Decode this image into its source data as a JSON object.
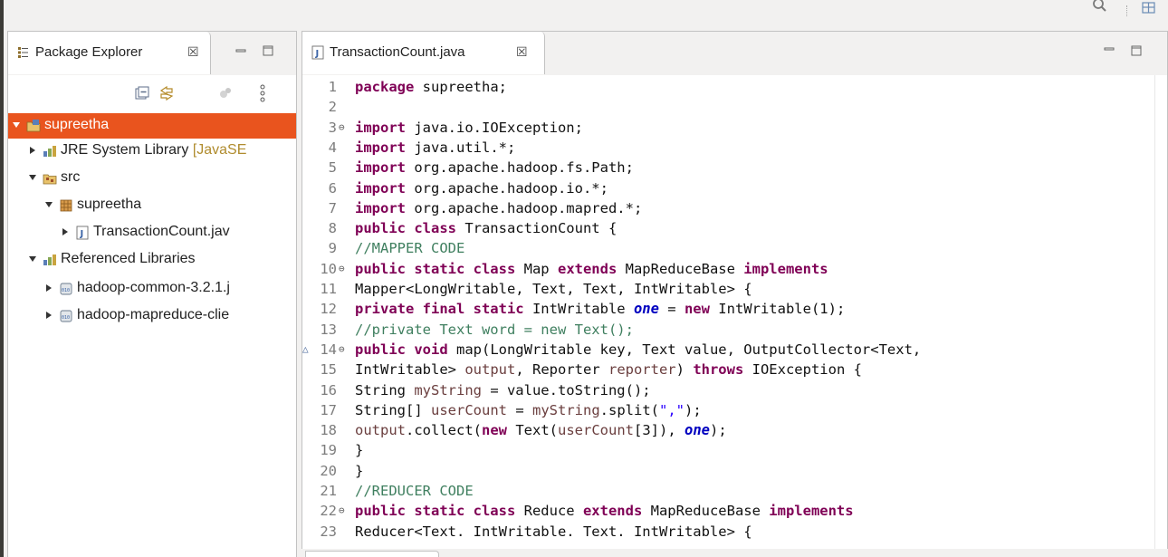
{
  "package_explorer": {
    "tab_label": "Package Explorer",
    "close_glyph": "☒",
    "tree": [
      {
        "label": "supreetha",
        "suffix": "",
        "icon": "project-icon",
        "expanded": true,
        "depth": 0,
        "selected": true
      },
      {
        "label": "JRE System Library ",
        "suffix": "[JavaSE",
        "icon": "library-icon",
        "expanded": false,
        "depth": 1,
        "selected": false
      },
      {
        "label": "src",
        "suffix": "",
        "icon": "source-folder-icon",
        "expanded": true,
        "depth": 1,
        "selected": false
      },
      {
        "label": "supreetha",
        "suffix": "",
        "icon": "package-icon",
        "expanded": true,
        "depth": 2,
        "selected": false
      },
      {
        "label": "TransactionCount.jav",
        "suffix": "",
        "icon": "java-file-icon",
        "expanded": false,
        "depth": 3,
        "selected": false
      },
      {
        "label": "Referenced Libraries",
        "suffix": "",
        "icon": "library-icon",
        "expanded": true,
        "depth": 1,
        "selected": false
      },
      {
        "label": "hadoop-common-3.2.1.j",
        "suffix": "",
        "icon": "jar-icon",
        "expanded": false,
        "depth": 2,
        "selected": false
      },
      {
        "label": "hadoop-mapreduce-clie",
        "suffix": "",
        "icon": "jar-icon",
        "expanded": false,
        "depth": 2,
        "selected": false
      }
    ]
  },
  "editor": {
    "tab_label": "TransactionCount.java",
    "close_glyph": "☒",
    "lines": [
      {
        "n": "1",
        "fold": "",
        "override": "",
        "tokens": [
          [
            "kw",
            "package"
          ],
          [
            "pl",
            " supreetha;"
          ]
        ]
      },
      {
        "n": "2",
        "fold": "",
        "override": "",
        "tokens": []
      },
      {
        "n": "3",
        "fold": "⊖",
        "override": "",
        "tokens": [
          [
            "kw",
            "import"
          ],
          [
            "pl",
            " java.io.IOException;"
          ]
        ]
      },
      {
        "n": "4",
        "fold": "",
        "override": "",
        "tokens": [
          [
            "kw",
            "import"
          ],
          [
            "pl",
            " java.util.*;"
          ]
        ]
      },
      {
        "n": "5",
        "fold": "",
        "override": "",
        "tokens": [
          [
            "kw",
            "import"
          ],
          [
            "pl",
            " org.apache.hadoop.fs.Path;"
          ]
        ]
      },
      {
        "n": "6",
        "fold": "",
        "override": "",
        "tokens": [
          [
            "kw",
            "import"
          ],
          [
            "pl",
            " org.apache.hadoop.io.*;"
          ]
        ]
      },
      {
        "n": "7",
        "fold": "",
        "override": "",
        "tokens": [
          [
            "kw",
            "import"
          ],
          [
            "pl",
            " org.apache.hadoop.mapred.*;"
          ]
        ]
      },
      {
        "n": "8",
        "fold": "",
        "override": "",
        "tokens": [
          [
            "kw",
            "public class"
          ],
          [
            "pl",
            " TransactionCount {"
          ]
        ]
      },
      {
        "n": "9",
        "fold": "",
        "override": "",
        "tokens": [
          [
            "cm",
            "//MAPPER CODE"
          ]
        ]
      },
      {
        "n": "10",
        "fold": "⊖",
        "override": "",
        "tokens": [
          [
            "kw",
            "public static class"
          ],
          [
            "pl",
            " Map "
          ],
          [
            "kw",
            "extends"
          ],
          [
            "pl",
            " MapReduceBase "
          ],
          [
            "kw",
            "implements"
          ]
        ]
      },
      {
        "n": "11",
        "fold": "",
        "override": "",
        "tokens": [
          [
            "pl",
            "Mapper<LongWritable, Text, Text, IntWritable> {"
          ]
        ]
      },
      {
        "n": "12",
        "fold": "",
        "override": "",
        "tokens": [
          [
            "kw",
            "private final static"
          ],
          [
            "pl",
            " IntWritable "
          ],
          [
            "fld",
            "one"
          ],
          [
            "pl",
            " = "
          ],
          [
            "kw",
            "new"
          ],
          [
            "pl",
            " IntWritable(1);"
          ]
        ]
      },
      {
        "n": "13",
        "fold": "",
        "override": "",
        "tokens": [
          [
            "cm",
            "//private Text word = new Text();"
          ]
        ]
      },
      {
        "n": "14",
        "fold": "⊖",
        "override": "△",
        "tokens": [
          [
            "kw",
            "public void"
          ],
          [
            "pl",
            " map(LongWritable key, Text value, OutputCollector<Text,"
          ]
        ]
      },
      {
        "n": "15",
        "fold": "",
        "override": "",
        "tokens": [
          [
            "pl",
            "IntWritable> "
          ],
          [
            "var",
            "output"
          ],
          [
            "pl",
            ", Reporter "
          ],
          [
            "var",
            "reporter"
          ],
          [
            "pl",
            ") "
          ],
          [
            "kw",
            "throws"
          ],
          [
            "pl",
            " IOException {"
          ]
        ]
      },
      {
        "n": "16",
        "fold": "",
        "override": "",
        "tokens": [
          [
            "pl",
            "String "
          ],
          [
            "var",
            "myString"
          ],
          [
            "pl",
            " = value.toString();"
          ]
        ]
      },
      {
        "n": "17",
        "fold": "",
        "override": "",
        "tokens": [
          [
            "pl",
            "String[] "
          ],
          [
            "var",
            "userCount"
          ],
          [
            "pl",
            " = "
          ],
          [
            "var",
            "myString"
          ],
          [
            "pl",
            ".split("
          ],
          [
            "str",
            "\",\""
          ],
          [
            "pl",
            ");"
          ]
        ]
      },
      {
        "n": "18",
        "fold": "",
        "override": "",
        "tokens": [
          [
            "var",
            "output"
          ],
          [
            "pl",
            ".collect("
          ],
          [
            "kw",
            "new"
          ],
          [
            "pl",
            " Text("
          ],
          [
            "var",
            "userCount"
          ],
          [
            "pl",
            "[3]), "
          ],
          [
            "fld",
            "one"
          ],
          [
            "pl",
            ");"
          ]
        ]
      },
      {
        "n": "19",
        "fold": "",
        "override": "",
        "tokens": [
          [
            "pl",
            "}"
          ]
        ]
      },
      {
        "n": "20",
        "fold": "",
        "override": "",
        "tokens": [
          [
            "pl",
            "}"
          ]
        ]
      },
      {
        "n": "21",
        "fold": "",
        "override": "",
        "tokens": [
          [
            "cm",
            "//REDUCER CODE"
          ]
        ]
      },
      {
        "n": "22",
        "fold": "⊖",
        "override": "",
        "tokens": [
          [
            "kw",
            "public static class"
          ],
          [
            "pl",
            " Reduce "
          ],
          [
            "kw",
            "extends"
          ],
          [
            "pl",
            " MapReduceBase "
          ],
          [
            "kw",
            "implements"
          ]
        ]
      },
      {
        "n": "23",
        "fold": "",
        "override": "",
        "tokens": [
          [
            "pl",
            "Reducer<Text. IntWritable. Text. IntWritable> {"
          ]
        ]
      }
    ]
  },
  "colors": {
    "selection": "#e9541e",
    "keyword": "#7f0055",
    "comment": "#3f7f5f",
    "string": "#2a00ff",
    "field": "#0000c0",
    "variable": "#6a3e3e"
  }
}
